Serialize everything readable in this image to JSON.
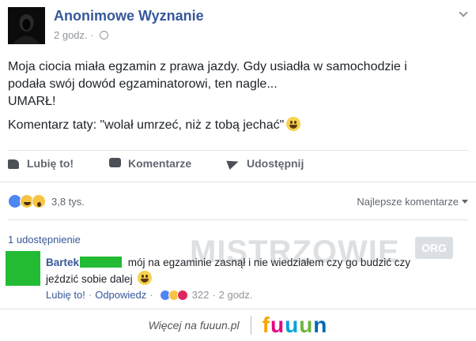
{
  "post": {
    "author": "Anonimowe Wyznanie",
    "time": "2 godz. ·",
    "text_line1": "Moja ciocia miała egzamin z prawa jazdy. Gdy usiadła w samochodzie i",
    "text_line2": "podała swój dowód egzaminatorowi, ten nagle...",
    "text_line3": "UMARŁ!",
    "comment_line": "Komentarz taty: \"wolał umrzeć, niż z tobą jechać\""
  },
  "actions": {
    "like": "Lubię to!",
    "comment": "Komentarze",
    "share": "Udostępnij"
  },
  "reactions": {
    "count": "3,8 tys.",
    "sort_label": "Najlepsze komentarze"
  },
  "shares_text": "1 udostępnienie",
  "watermark": {
    "text": "MISTRZOWIE",
    "badge": "ORG"
  },
  "comment": {
    "name": "Bartek",
    "text": "mój na egzaminie zasnął i nie wiedziałem czy go budzić czy jeździć sobie dalej",
    "like": "Lubię to!",
    "reply": "Odpowiedz",
    "reaction_count": "322",
    "time": "2 godz.",
    "dot": "·"
  },
  "footer": {
    "more": "Więcej na fuuun.pl",
    "logo": [
      "f",
      "u",
      "u",
      "u",
      "n"
    ]
  },
  "colors": {
    "link": "#365899",
    "muted": "#90949c",
    "comment_avatar": "#22bb33"
  }
}
